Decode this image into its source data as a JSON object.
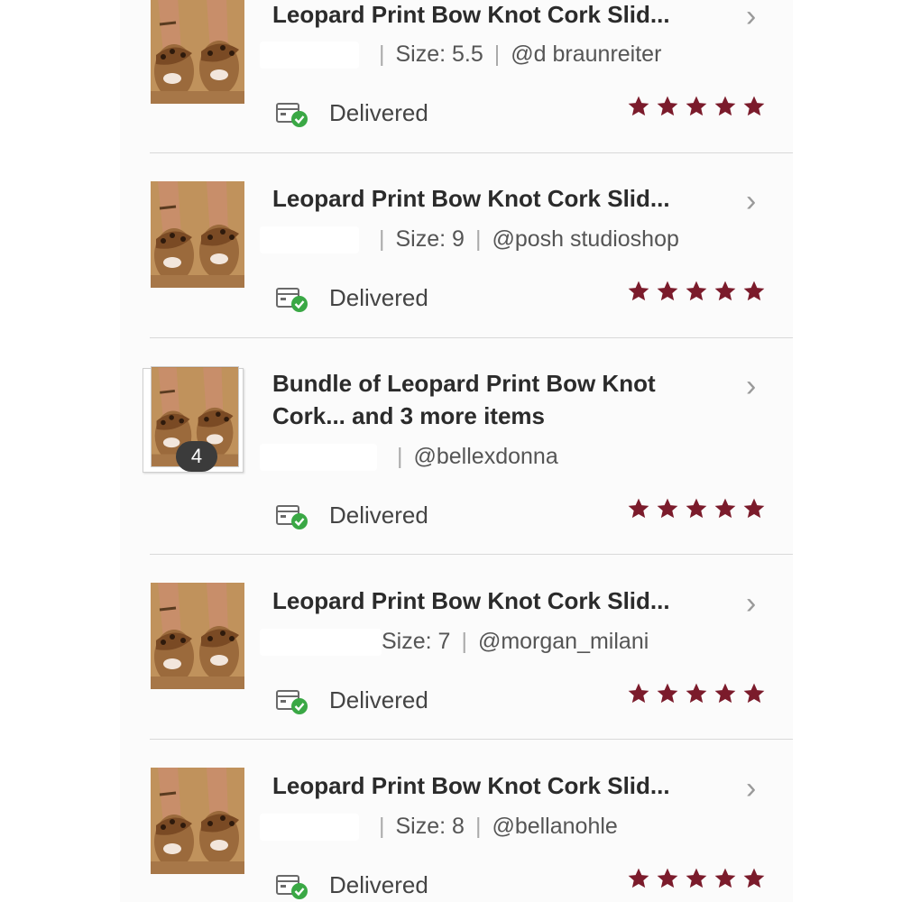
{
  "colors": {
    "star": "#7b1b2b",
    "check": "#3aa845",
    "badge_bg": "#3b3b3b"
  },
  "orders": [
    {
      "title": "Leopard Print Bow Knot Cork Slid...",
      "size": "Size: 5.5",
      "seller": "@d braunreiter",
      "status": "Delivered",
      "rating": 5
    },
    {
      "title": "Leopard Print Bow Knot Cork Slid...",
      "size": "Size: 9",
      "seller": "@posh studioshop",
      "status": "Delivered",
      "rating": 5
    },
    {
      "title_line1": "Bundle of Leopard Print Bow Knot",
      "title_line2": "Cork... and 3 more items",
      "badge": "4",
      "seller": "@bellexdonna",
      "status": "Delivered",
      "rating": 5
    },
    {
      "title": "Leopard Print Bow Knot Cork Slid...",
      "size": "Size: 7",
      "seller": "@morgan_milani",
      "status": "Delivered",
      "rating": 5
    },
    {
      "title": "Leopard Print Bow Knot Cork Slid...",
      "size": "Size: 8",
      "seller": "@bellanohle",
      "status": "Delivered",
      "rating": 5
    }
  ],
  "icons": {
    "chevron": "chevron-right-icon",
    "delivered": "package-check-icon",
    "star": "star-icon"
  }
}
